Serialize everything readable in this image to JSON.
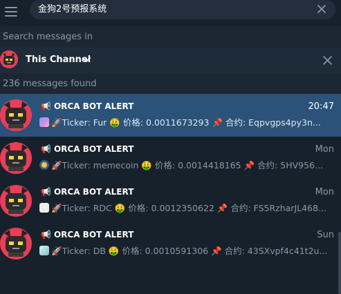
{
  "search": {
    "query": "金狗2号预报系统",
    "scope_label": "Search messages in"
  },
  "channel_filter": {
    "name": "This Channel"
  },
  "results_count": "236 messages found",
  "results": [
    {
      "title": "ORCA BOT ALERT",
      "date": "20:47",
      "selected": true,
      "snippet": "🚀Ticker: Fur 🤑 价格: 0.0011673293 📌 合约: Eqpvgps4py3n..."
    },
    {
      "title": "ORCA BOT ALERT",
      "date": "Mon",
      "selected": false,
      "snippet": "🚀Ticker: memecoin 🤑 价格: 0.0014418165 📌 合约: 5HV956..."
    },
    {
      "title": "ORCA BOT ALERT",
      "date": "Mon",
      "selected": false,
      "snippet": "🚀Ticker: RDC 🤑 价格: 0.0012350622 📌 合约: FS5RzharJL468..."
    },
    {
      "title": "ORCA BOT ALERT",
      "date": "Sun",
      "selected": false,
      "snippet": "🚀Ticker: DB 🤑 价格: 0.0010591306 📌 合约: 43SXvpf4c41t2u..."
    }
  ],
  "colors": {
    "background": "#17212b",
    "selected": "#2b5278",
    "muted_text": "#8b98a5"
  }
}
